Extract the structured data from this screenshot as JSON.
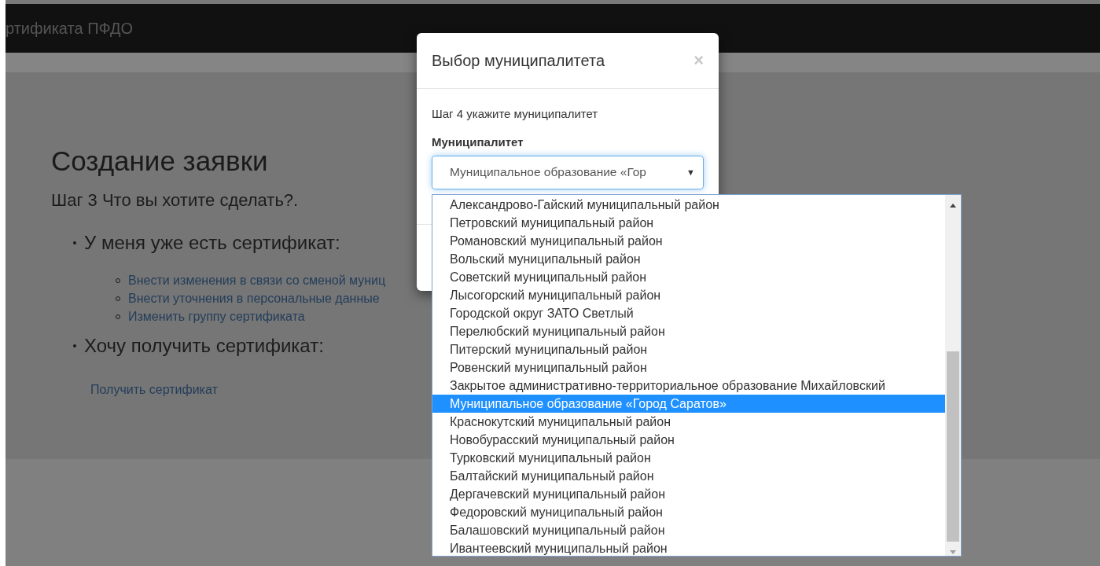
{
  "navbar": {
    "brand": "ртификата ПФДО"
  },
  "page": {
    "title": "Создание заявки",
    "step": "Шаг 3 Что вы хотите сделать?.",
    "sections": [
      {
        "heading": "У меня уже есть сертификат:",
        "links": [
          {
            "kind": "bullet",
            "label": "Внести изменения в связи со сменой муниц"
          },
          {
            "kind": "bullet",
            "label": "Внести уточнения в персональные данные"
          },
          {
            "kind": "bullet",
            "label": "Изменить группу сертификата"
          }
        ]
      },
      {
        "heading": "Хочу получить сертификат:",
        "links": [
          {
            "kind": "plain",
            "label": "Получить сертификат"
          }
        ]
      }
    ]
  },
  "modal": {
    "title": "Выбор муниципалитета",
    "close": "×",
    "step_text": "Шаг 4 укажите муниципалитет",
    "label": "Муниципалитет",
    "select": {
      "value": "Муниципальное образование «Гор",
      "arrow": "▼"
    },
    "options": [
      {
        "label": "Александрово-Гайский муниципальный район",
        "selected": false
      },
      {
        "label": "Петровский муниципальный район",
        "selected": false
      },
      {
        "label": "Романовский муниципальный район",
        "selected": false
      },
      {
        "label": "Вольский муниципальный район",
        "selected": false
      },
      {
        "label": "Советский муниципальный район",
        "selected": false
      },
      {
        "label": "Лысогорский муниципальный район",
        "selected": false
      },
      {
        "label": "Городской округ ЗАТО Светлый",
        "selected": false
      },
      {
        "label": "Перелюбский муниципальный район",
        "selected": false
      },
      {
        "label": "Питерский муниципальный район",
        "selected": false
      },
      {
        "label": "Ровенский муниципальный район",
        "selected": false
      },
      {
        "label": "Закрытое административно-территориальное образование Михайловский",
        "selected": false
      },
      {
        "label": "Муниципальное образование «Город Саратов»",
        "selected": true
      },
      {
        "label": "Краснокутский муниципальный район",
        "selected": false
      },
      {
        "label": "Новобурасский муниципальный район",
        "selected": false
      },
      {
        "label": "Турковский муниципальный район",
        "selected": false
      },
      {
        "label": "Балтайский муниципальный район",
        "selected": false
      },
      {
        "label": "Дергачевский муниципальный район",
        "selected": false
      },
      {
        "label": "Федоровский муниципальный район",
        "selected": false
      },
      {
        "label": "Балашовский муниципальный район",
        "selected": false
      },
      {
        "label": "Ивантеевский муниципальный район",
        "selected": false
      }
    ]
  }
}
